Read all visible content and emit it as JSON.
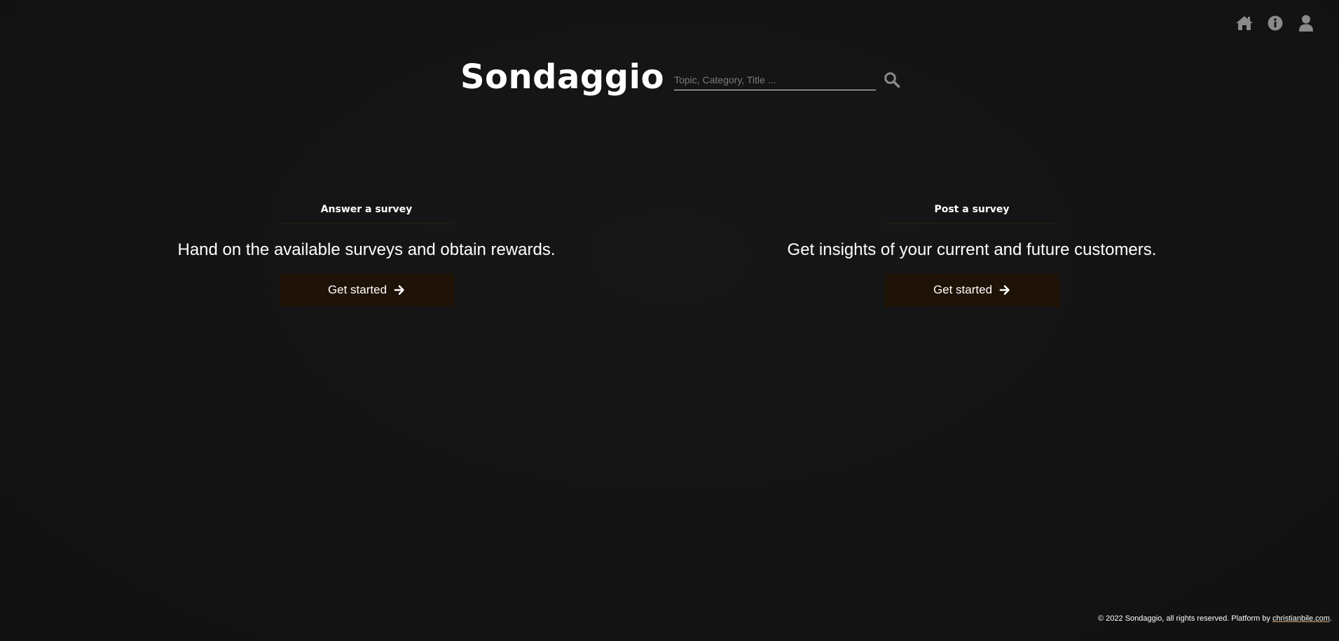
{
  "nav": {
    "icons": [
      "home-icon",
      "info-icon",
      "user-icon"
    ],
    "icon_color": "#8a8a8a"
  },
  "header": {
    "logo": "Sondaggio",
    "search_placeholder": "Topic, Category, Title ...",
    "search_value": ""
  },
  "sections": {
    "answer": {
      "title": "Answer a survey",
      "description": "Hand on the available surveys and obtain rewards.",
      "button_label": "Get started"
    },
    "post": {
      "title": "Post a survey",
      "description": "Get insights of your current and future customers.",
      "button_label": "Get started"
    }
  },
  "footer": {
    "text": "© 2022 Sondaggio, all rights reserved. Platform by ",
    "link": "christianbile.com",
    "suffix": "."
  },
  "colors": {
    "background": "#141414",
    "button_bg": "#1f1207",
    "divider": "#2e1d0b",
    "link_underline": "#d9a66b"
  }
}
